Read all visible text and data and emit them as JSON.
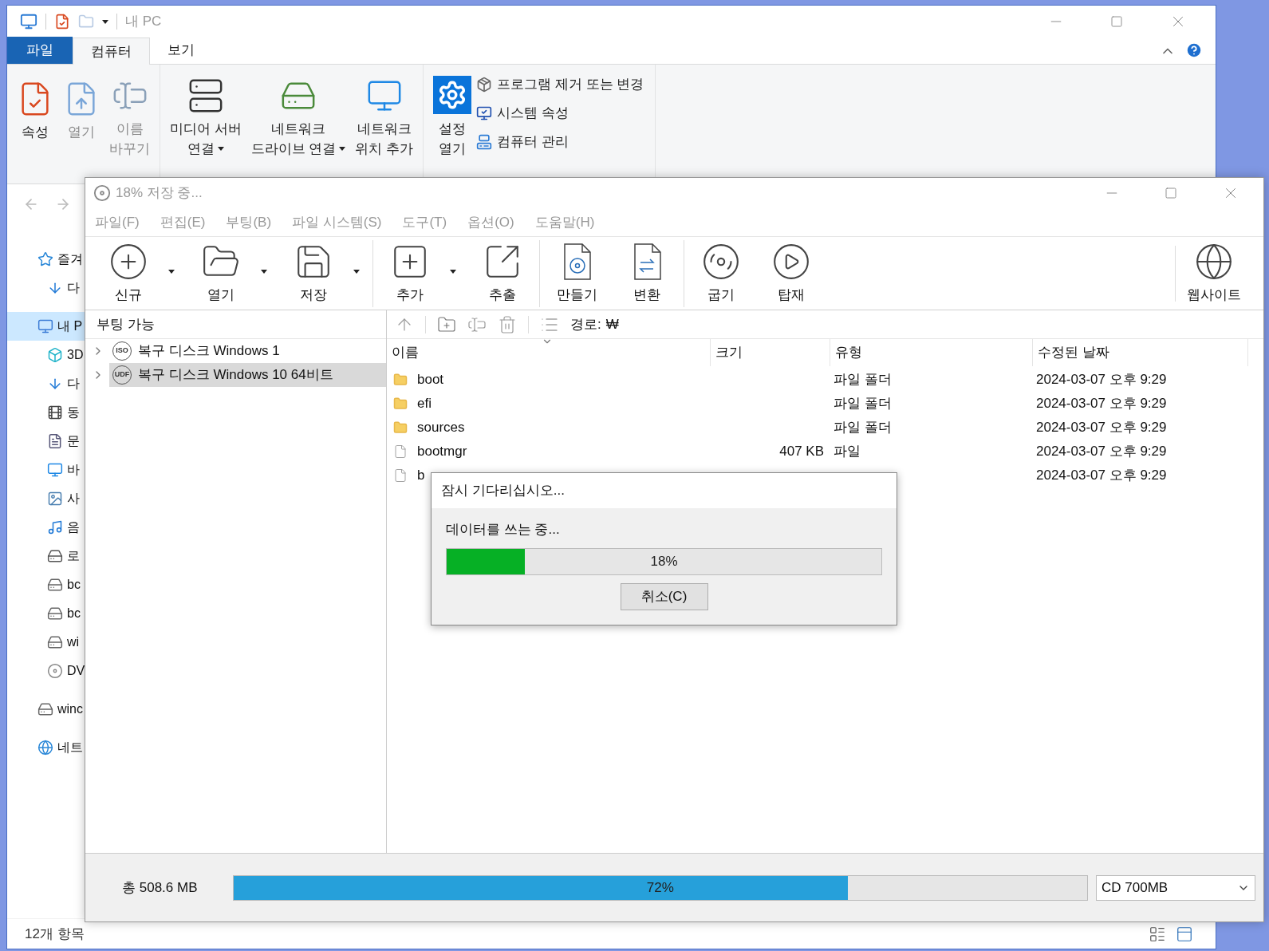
{
  "explorer": {
    "title": "내 PC",
    "tabs": [
      {
        "label": "파일",
        "selected": false
      },
      {
        "label": "컴퓨터",
        "selected": true
      },
      {
        "label": "보기",
        "selected": false
      }
    ],
    "ribbon_groups": [
      {
        "large": [
          {
            "lines": [
              "속성"
            ],
            "disabled": false,
            "dropdown": false
          },
          {
            "lines": [
              "열기"
            ],
            "disabled": true,
            "dropdown": false
          },
          {
            "lines": [
              "이름",
              "바꾸기"
            ],
            "disabled": true,
            "dropdown": false
          }
        ]
      },
      {
        "large": [
          {
            "lines": [
              "미디어 서버",
              "연결"
            ],
            "disabled": false,
            "dropdown": true
          },
          {
            "lines": [
              "네트워크",
              "드라이브 연결"
            ],
            "disabled": false,
            "dropdown": true
          },
          {
            "lines": [
              "네트워크",
              "위치 추가"
            ],
            "disabled": false,
            "dropdown": false
          }
        ]
      },
      {
        "large": [
          {
            "lines": [
              "설정",
              "열기"
            ],
            "disabled": false,
            "dropdown": false
          }
        ],
        "small": [
          "프로그램 제거 또는 변경",
          "시스템 속성",
          "컴퓨터 관리"
        ]
      }
    ],
    "nav": [
      {
        "label": "즐겨",
        "selected": false,
        "children": [
          {
            "label": "다",
            "selected": false
          }
        ]
      },
      {
        "label": "내 P",
        "selected": true,
        "children": [
          {
            "label": "3D",
            "selected": false
          },
          {
            "label": "다",
            "selected": false
          },
          {
            "label": "동",
            "selected": false
          },
          {
            "label": "문",
            "selected": false
          },
          {
            "label": "바",
            "selected": false
          },
          {
            "label": "사",
            "selected": false
          },
          {
            "label": "음",
            "selected": false
          },
          {
            "label": "로",
            "selected": false
          },
          {
            "label": "bc",
            "selected": false
          },
          {
            "label": "bc",
            "selected": false
          },
          {
            "label": "wi",
            "selected": false
          },
          {
            "label": "DV",
            "selected": false
          }
        ]
      },
      {
        "label": "winc",
        "selected": false
      },
      {
        "label": "네트",
        "selected": false
      }
    ],
    "status": "12개 항목"
  },
  "iso": {
    "title": "18% 저장 중...",
    "menu": [
      "파일(F)",
      "편집(E)",
      "부팅(B)",
      "파일 시스템(S)",
      "도구(T)",
      "옵션(O)",
      "도움말(H)"
    ],
    "toolbar": [
      {
        "label": "신규",
        "dropdown": true,
        "separator_after": false
      },
      {
        "label": "열기",
        "dropdown": true,
        "separator_after": false
      },
      {
        "label": "저장",
        "dropdown": true,
        "separator_after": true
      },
      {
        "label": "추가",
        "dropdown": true,
        "separator_after": false
      },
      {
        "label": "추출",
        "dropdown": false,
        "separator_after": true
      },
      {
        "label": "만들기",
        "dropdown": false,
        "separator_after": false
      },
      {
        "label": "변환",
        "dropdown": false,
        "separator_after": true
      },
      {
        "label": "굽기",
        "dropdown": false,
        "separator_after": false
      },
      {
        "label": "탑재",
        "dropdown": false,
        "separator_after": false
      }
    ],
    "website": {
      "label": "웹사이트"
    },
    "tree_header": "부팅 가능",
    "tree": [
      {
        "badge": "ISO",
        "label": "복구 디스크 Windows 1",
        "selected": false,
        "expanded": false
      },
      {
        "badge": "UDF",
        "label": "복구 디스크 Windows 10 64비트",
        "selected": true,
        "expanded": false
      }
    ],
    "path": {
      "label": "경로:",
      "value": "₩"
    },
    "columns": [
      "이름",
      "크기",
      "유형",
      "수정된 날짜"
    ],
    "rows": [
      {
        "kind": "folder",
        "name": "boot",
        "type": "파일 폴더",
        "date": "2024-03-07 오후 9:29"
      },
      {
        "kind": "folder",
        "name": "efi",
        "type": "파일 폴더",
        "date": "2024-03-07 오후 9:29"
      },
      {
        "kind": "folder",
        "name": "sources",
        "type": "파일 폴더",
        "date": "2024-03-07 오후 9:29"
      },
      {
        "kind": "file",
        "name": "bootmgr",
        "size": "407 KB",
        "type": "파일",
        "date": "2024-03-07 오후 9:29"
      },
      {
        "kind": "file",
        "name": "b",
        "date": "2024-03-07 오후 9:29"
      }
    ],
    "total": "총 508.6 MB",
    "capacity": {
      "level": 0.72,
      "reading": "72%"
    },
    "media": "CD 700MB",
    "dialog": {
      "title": "잠시 기다리십시오...",
      "message": "데이터를 쓰는 중...",
      "progress": {
        "level": 0.18,
        "reading": "18%"
      },
      "button": "취소(C)"
    }
  }
}
